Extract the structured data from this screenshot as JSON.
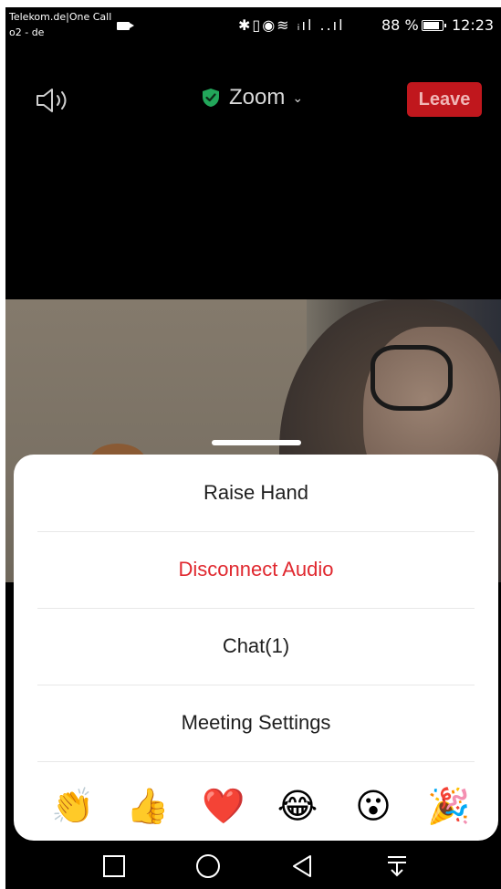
{
  "status_bar": {
    "carrier_line1": "Telekom.de|One Call",
    "carrier_line2": "o2 - de",
    "system_icons": "✱▯◉≋ ᵢıl ..ıl",
    "battery_percent": "88 %",
    "battery_level": 0.88,
    "time": "12:23"
  },
  "top_bar": {
    "speaker_icon": "speaker-icon",
    "meeting_title": "Zoom",
    "title_chevron": "⌄",
    "leave_label": "Leave"
  },
  "menu": {
    "items": [
      {
        "label": "Raise Hand",
        "color": "#1f1f1f"
      },
      {
        "label": "Disconnect Audio",
        "color": "#e0282f"
      },
      {
        "label": "Chat(1)",
        "color": "#1f1f1f"
      },
      {
        "label": "Meeting Settings",
        "color": "#1f1f1f"
      }
    ]
  },
  "reactions": [
    {
      "name": "clapping-hands-icon",
      "glyph": "👏"
    },
    {
      "name": "thumbs-up-icon",
      "glyph": "👍"
    },
    {
      "name": "heart-icon",
      "glyph": "❤️"
    },
    {
      "name": "tears-of-joy-icon",
      "glyph": "😂"
    },
    {
      "name": "surprised-face-icon",
      "glyph": "😮"
    },
    {
      "name": "party-popper-icon",
      "glyph": "🎉"
    }
  ],
  "nav_bar": {
    "recent_icon": "square-icon",
    "home_icon": "circle-icon",
    "back_icon": "triangle-back-icon",
    "notification_icon": "pull-down-icon"
  },
  "colors": {
    "leave_bg": "#c0171d",
    "shield_green": "#22a65a",
    "sheet_bg": "#ffffff"
  }
}
